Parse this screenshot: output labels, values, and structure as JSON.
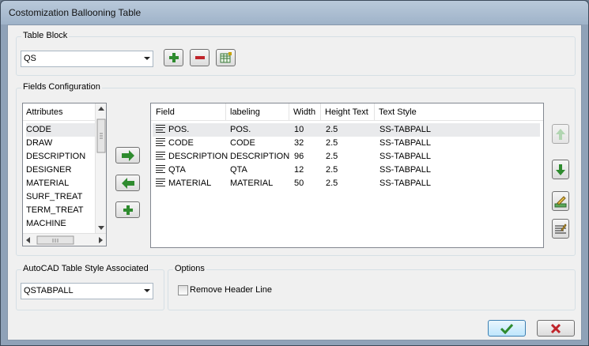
{
  "window": {
    "title": "Costomization Ballooning Table"
  },
  "table_block": {
    "group_label": "Table Block",
    "selected": "QS",
    "add_icon": "plus-icon",
    "remove_icon": "minus-icon",
    "table_icon": "table-edit-icon"
  },
  "fields_config": {
    "group_label": "Fields Configuration",
    "attributes": {
      "header": "Attributes",
      "items": [
        "CODE",
        "DRAW",
        "DESCRIPTION",
        "DESIGNER",
        "MATERIAL",
        "SURF_TREAT",
        "TERM_TREAT",
        "MACHINE"
      ],
      "selected_index": 0
    },
    "middle_buttons": [
      "arrow-right-icon",
      "arrow-left-icon",
      "plus-icon"
    ],
    "fields_table": {
      "columns": [
        "Field",
        "labeling",
        "Width",
        "Height Text",
        "Text Style"
      ],
      "rows": [
        {
          "field": "POS.",
          "labeling": "POS.",
          "width": "10",
          "height_text": "2.5",
          "text_style": "SS-TABPALL"
        },
        {
          "field": "CODE",
          "labeling": "CODE",
          "width": "32",
          "height_text": "2.5",
          "text_style": "SS-TABPALL"
        },
        {
          "field": "DESCRIPTION",
          "labeling": "DESCRIPTION",
          "width": "96",
          "height_text": "2.5",
          "text_style": "SS-TABPALL"
        },
        {
          "field": "QTA",
          "labeling": "QTA",
          "width": "12",
          "height_text": "2.5",
          "text_style": "SS-TABPALL"
        },
        {
          "field": "MATERIAL",
          "labeling": "MATERIAL",
          "width": "50",
          "height_text": "2.5",
          "text_style": "SS-TABPALL"
        }
      ],
      "selected_index": 0
    },
    "side_buttons": [
      "move-up-icon",
      "move-down-icon",
      "edit-icon",
      "properties-icon"
    ]
  },
  "autocad_style": {
    "group_label": "AutoCAD Table Style Associated",
    "selected": "QSTABPALL"
  },
  "options": {
    "group_label": "Options",
    "remove_header_label": "Remove Header Line",
    "remove_header_checked": false
  },
  "dialog_buttons": {
    "ok_icon": "check-icon",
    "cancel_icon": "close-icon"
  },
  "colors": {
    "accent_green": "#2e8b2e",
    "accent_red": "#c0242a",
    "selection": "#e9eaec"
  }
}
